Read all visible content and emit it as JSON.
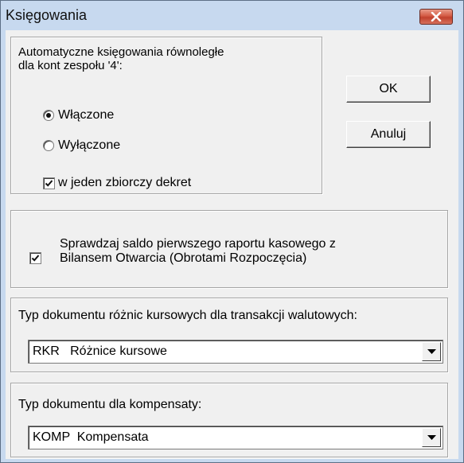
{
  "window": {
    "title": "Księgowania"
  },
  "auto_posting": {
    "label_line1": "Automatyczne księgowania równoległe",
    "label_line2": "dla kont zespołu '4':",
    "options": [
      {
        "label": "Włączone",
        "selected": true
      },
      {
        "label": "Wyłączone",
        "selected": false
      }
    ],
    "single_entry": {
      "label": "w jeden zbiorczy dekret",
      "checked": true
    }
  },
  "buttons": {
    "ok": "OK",
    "cancel": "Anuluj"
  },
  "cash_report_check": {
    "label_line1": "Sprawdzaj saldo pierwszego raportu kasowego z",
    "label_line2": "Bilansem Otwarcia (Obrotami Rozpoczęcia)",
    "checked": true
  },
  "exchange_diff": {
    "label": "Typ dokumentu różnic kursowych dla transakcji walutowych:",
    "value": "RKR   Różnice kursowe"
  },
  "compensation": {
    "label": "Typ dokumentu dla kompensaty:",
    "value": "KOMP  Kompensata"
  },
  "colors": {
    "frame": "#c7d9ef",
    "close": "#c1412d",
    "face": "#f0f0f0"
  },
  "icons": {
    "close": "close-icon",
    "dropdown": "chevron-down-icon"
  }
}
